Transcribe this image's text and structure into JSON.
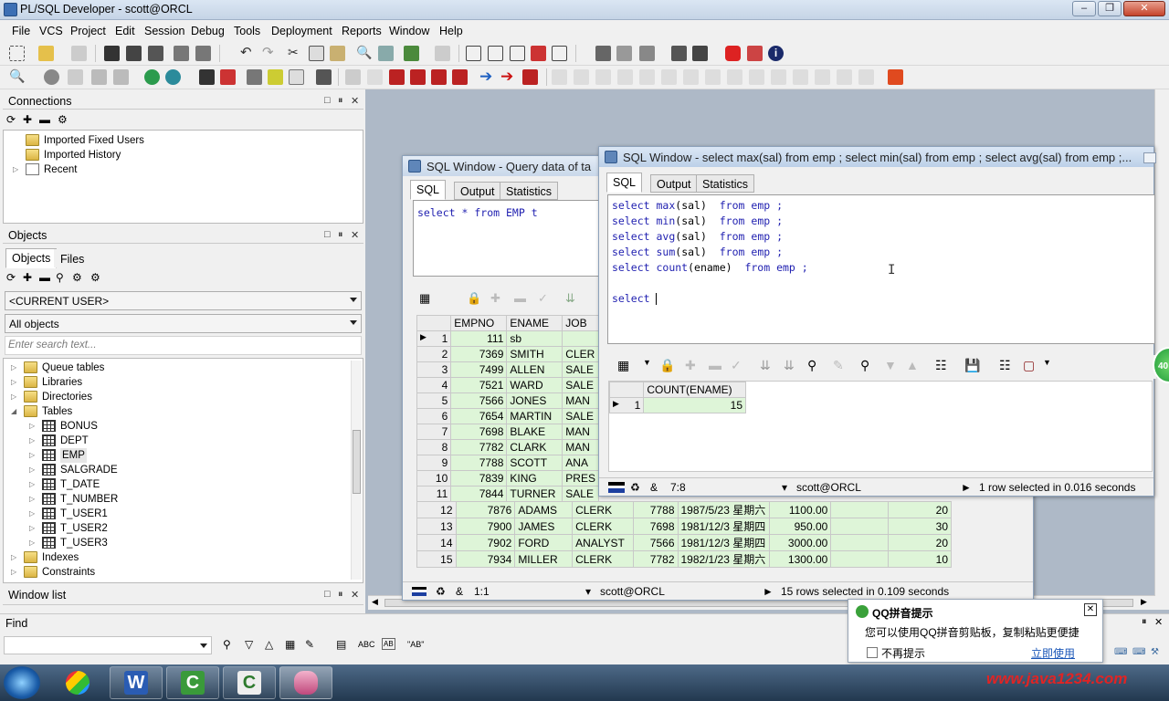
{
  "app": {
    "title": "PL/SQL Developer - scott@ORCL"
  },
  "menu": [
    "File",
    "VCS",
    "Project",
    "Edit",
    "Session",
    "Debug",
    "Tools",
    "Deployment",
    "Reports",
    "Window",
    "Help"
  ],
  "connections": {
    "title": "Connections",
    "items": [
      "Imported Fixed Users",
      "Imported History",
      "Recent"
    ]
  },
  "objects": {
    "title": "Objects",
    "tabs": [
      "Objects",
      "Files"
    ],
    "user_select": "<CURRENT USER>",
    "filter_select": "All objects",
    "search_placeholder": "Enter search text...",
    "tree": [
      {
        "label": "Queue tables",
        "level": 0,
        "kind": "folder"
      },
      {
        "label": "Libraries",
        "level": 0,
        "kind": "folder"
      },
      {
        "label": "Directories",
        "level": 0,
        "kind": "folder"
      },
      {
        "label": "Tables",
        "level": 0,
        "kind": "folder",
        "expanded": true
      },
      {
        "label": "BONUS",
        "level": 1,
        "kind": "table"
      },
      {
        "label": "DEPT",
        "level": 1,
        "kind": "table"
      },
      {
        "label": "EMP",
        "level": 1,
        "kind": "table",
        "selected": true
      },
      {
        "label": "SALGRADE",
        "level": 1,
        "kind": "table"
      },
      {
        "label": "T_DATE",
        "level": 1,
        "kind": "table"
      },
      {
        "label": "T_NUMBER",
        "level": 1,
        "kind": "table"
      },
      {
        "label": "T_USER1",
        "level": 1,
        "kind": "table"
      },
      {
        "label": "T_USER2",
        "level": 1,
        "kind": "table"
      },
      {
        "label": "T_USER3",
        "level": 1,
        "kind": "table"
      },
      {
        "label": "Indexes",
        "level": 0,
        "kind": "folder"
      },
      {
        "label": "Constraints",
        "level": 0,
        "kind": "folder"
      }
    ]
  },
  "window_list": {
    "title": "Window list"
  },
  "find": {
    "title": "Find",
    "abc": "ABC",
    "ab_quoted": "\"AB\""
  },
  "sql_window_back": {
    "title": "SQL Window - Query data of ta",
    "tabs": [
      "SQL",
      "Output",
      "Statistics"
    ],
    "query_parts": [
      "select",
      "*",
      "from",
      "EMP",
      "t"
    ],
    "columns": [
      "EMPNO",
      "ENAME",
      "JOB"
    ],
    "rows": [
      [
        "1",
        "111",
        "sb",
        ""
      ],
      [
        "2",
        "7369",
        "SMITH",
        "CLER"
      ],
      [
        "3",
        "7499",
        "ALLEN",
        "SALE"
      ],
      [
        "4",
        "7521",
        "WARD",
        "SALE"
      ],
      [
        "5",
        "7566",
        "JONES",
        "MAN"
      ],
      [
        "6",
        "7654",
        "MARTIN",
        "SALE"
      ],
      [
        "7",
        "7698",
        "BLAKE",
        "MAN"
      ],
      [
        "8",
        "7782",
        "CLARK",
        "MAN"
      ],
      [
        "9",
        "7788",
        "SCOTT",
        "ANA"
      ],
      [
        "10",
        "7839",
        "KING",
        "PRES"
      ],
      [
        "11",
        "7844",
        "TURNER",
        "SALE"
      ]
    ],
    "visible_rows": [
      [
        "12",
        "7876",
        "ADAMS",
        "CLERK",
        "7788",
        "1987/5/23 星期六",
        "1100.00",
        "",
        "20"
      ],
      [
        "13",
        "7900",
        "JAMES",
        "CLERK",
        "7698",
        "1981/12/3 星期四",
        "950.00",
        "",
        "30"
      ],
      [
        "14",
        "7902",
        "FORD",
        "ANALYST",
        "7566",
        "1981/12/3 星期四",
        "3000.00",
        "",
        "20"
      ],
      [
        "15",
        "7934",
        "MILLER",
        "CLERK",
        "7782",
        "1982/1/23 星期六",
        "1300.00",
        "",
        "10"
      ]
    ],
    "status": {
      "pos": "1:1",
      "conn": "scott@ORCL",
      "msg": "15 rows selected in 0.109 seconds"
    }
  },
  "sql_window_front": {
    "title": "SQL Window - select max(sal) from emp ; select min(sal) from emp ; select avg(sal) from emp ;...",
    "tabs": [
      "SQL",
      "Output",
      "Statistics"
    ],
    "lines": [
      {
        "kw1": "select",
        "fn": "max",
        "arg": "(sal)",
        "kw2": "from",
        "tbl": "emp ;"
      },
      {
        "kw1": "select",
        "fn": "min",
        "arg": "(sal)",
        "kw2": "from",
        "tbl": "emp ;"
      },
      {
        "kw1": "select",
        "fn": "avg",
        "arg": "(sal)",
        "kw2": "from",
        "tbl": "emp ;"
      },
      {
        "kw1": "select",
        "fn": "sum",
        "arg": "(sal)",
        "kw2": "from",
        "tbl": "emp ;"
      },
      {
        "kw1": "select",
        "fn": "count",
        "arg": "(ename)",
        "kw2": "from",
        "tbl": "emp ;"
      }
    ],
    "current_line": "select ",
    "result_columns": [
      "COUNT(ENAME)"
    ],
    "result_rows": [
      [
        "1",
        "15"
      ]
    ],
    "status": {
      "pos": "7:8",
      "conn": "scott@ORCL",
      "msg": "1 row selected in 0.016 seconds"
    }
  },
  "qq_popup": {
    "title": "QQ拼音提示",
    "body": "您可以使用QQ拼音剪贴板，复制粘贴更便捷",
    "checkbox": "不再提示",
    "link": "立即使用"
  },
  "side_badge": "40",
  "watermark": "www.java1234.com",
  "colors": {
    "grid_green": "#def5d8",
    "keyword": "#1f1fb0",
    "titlebar": "#c9d8ea"
  }
}
